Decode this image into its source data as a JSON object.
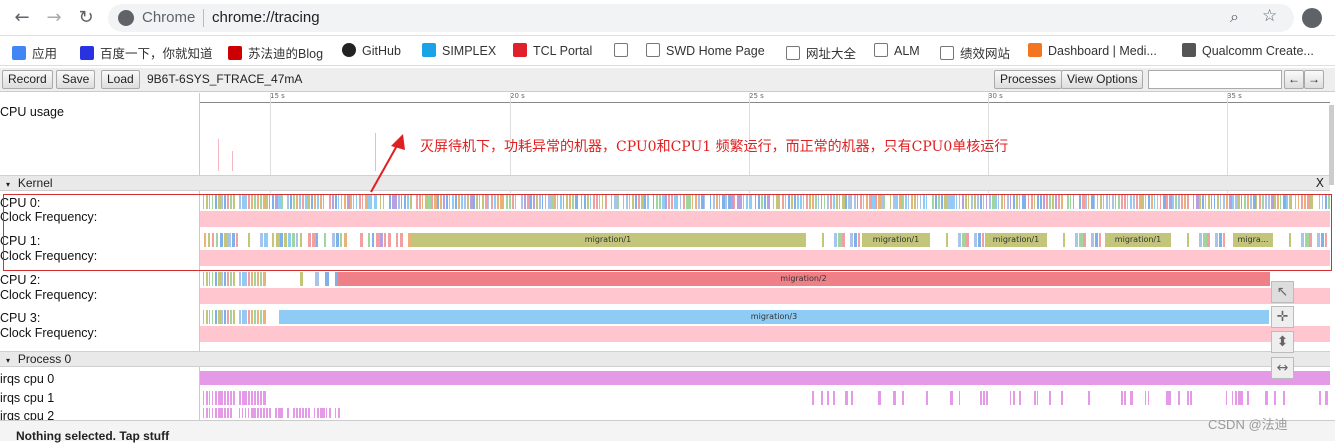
{
  "browser": {
    "site_label": "Chrome",
    "url": "chrome://tracing",
    "icons": {
      "back": "back-arrow-icon",
      "forward": "forward-arrow-icon",
      "reload": "reload-icon",
      "site": "site-info-icon",
      "zoom": "zoom-icon",
      "star": "star-icon",
      "profile": "profile-icon"
    }
  },
  "bookmarks": [
    {
      "label": "应用",
      "color": "#4285f4"
    },
    {
      "label": "百度一下，你就知道",
      "color": "#2932e1"
    },
    {
      "label": "苏法迪的Blog",
      "color": "#c00"
    },
    {
      "label": "GitHub",
      "color": "#222"
    },
    {
      "label": "SIMPLEX",
      "color": "#1aa3e8"
    },
    {
      "label": "TCL Portal",
      "color": "#e0202a"
    },
    {
      "label": "",
      "color": "#999"
    },
    {
      "label": "SWD Home Page",
      "color": "#999"
    },
    {
      "label": "网址大全",
      "color": "#999"
    },
    {
      "label": "ALM",
      "color": "#999"
    },
    {
      "label": "绩效网站",
      "color": "#999"
    },
    {
      "label": "Dashboard | Medi...",
      "color": "#f47521"
    },
    {
      "label": "Qualcomm Create...",
      "color": "#555"
    }
  ],
  "toolbar": {
    "record": "Record",
    "save": "Save",
    "load": "Load",
    "trace_name": "9B6T-6SYS_FTRACE_47mA",
    "processes": "Processes",
    "view_options": "View Options",
    "search_placeholder": "",
    "prev": "←",
    "next": "→"
  },
  "ruler": {
    "ticks": [
      "15 s",
      "20 s",
      "25 s",
      "30 s",
      "35 s"
    ]
  },
  "tracks": {
    "cpu_usage": "CPU usage",
    "kernel": "Kernel",
    "cpu0": "CPU 0:",
    "cpu1": "CPU 1:",
    "cpu2": "CPU 2:",
    "cpu3": "CPU 3:",
    "clock": "Clock Frequency:",
    "process0": "Process 0",
    "irqs0": "irqs cpu 0",
    "irqs1": "irqs cpu 1",
    "irqs2": "irqs cpu 2",
    "close": "X",
    "collapse": "▾"
  },
  "slices": {
    "cpu1": [
      "migration/1",
      "migration/1",
      "migration/1",
      "migration/1",
      "migra..."
    ],
    "cpu2": "migration/2",
    "cpu3": "migration/3"
  },
  "annotation": "灭屏待机下，功耗异常的机器，CPU0和CPU1 频繁运行，而正常的机器，只有CPU0单核运行",
  "bottom_text": "Nothing selected. Tap stuff",
  "watermark": "CSDN @法迪",
  "side_tools": {
    "select": "select-tool-icon",
    "pan": "pan-tool-icon",
    "zoom": "zoom-tool-icon",
    "timing": "timing-tool-icon"
  }
}
